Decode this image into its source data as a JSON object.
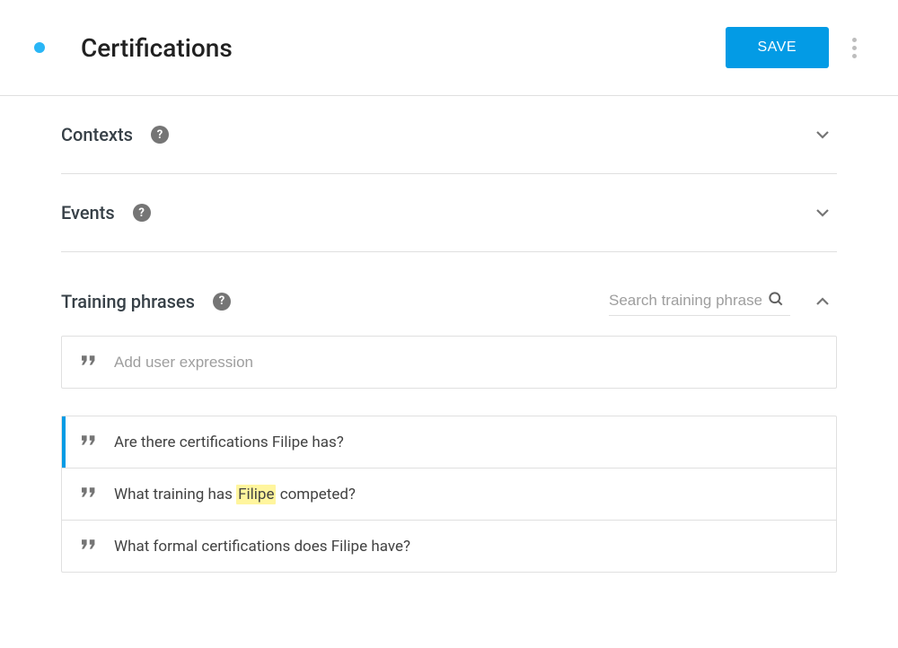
{
  "header": {
    "title": "Certifications",
    "save_label": "SAVE"
  },
  "sections": {
    "contexts": {
      "title": "Contexts",
      "expanded": false
    },
    "events": {
      "title": "Events",
      "expanded": false
    },
    "training": {
      "title": "Training phrases",
      "expanded": true,
      "search_placeholder": "Search training phrases",
      "add_placeholder": "Add user expression",
      "phrases": [
        {
          "segments": [
            {
              "text": "Are there certifications Filipe has?"
            }
          ],
          "active": true
        },
        {
          "segments": [
            {
              "text": "What training has "
            },
            {
              "text": "Filipe",
              "highlight": true
            },
            {
              "text": " competed?"
            }
          ],
          "active": false
        },
        {
          "segments": [
            {
              "text": "What formal certifications does Filipe have?"
            }
          ],
          "active": false
        }
      ]
    }
  }
}
